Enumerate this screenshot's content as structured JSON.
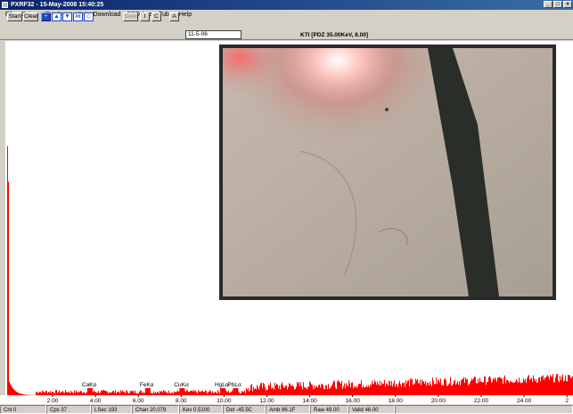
{
  "window": {
    "title": "PXRF32 - 15-May-2008 15:40:25"
  },
  "menu": [
    "File",
    "Setup",
    "ID",
    "Conv",
    "Cal",
    "Download",
    "PPD-Inte",
    "Tube",
    "Help"
  ],
  "toolbar": {
    "start": "Start",
    "clear": "Clear",
    "save": "Save",
    "i": "I",
    "c": "C",
    "a": "A",
    "sample_name": "11-5-06"
  },
  "status_label": "KTI  [PDZ 35.00KeV, 8.00]",
  "chart_data": {
    "type": "bar",
    "xlabel": "",
    "ylabel": "",
    "x_ticks": [
      "2.00",
      "4.00",
      "6.00",
      "8.00",
      "10.00",
      "12.00",
      "14.00",
      "16.00",
      "18.00",
      "20.00",
      "22.00",
      "24.00",
      "2"
    ],
    "annotations": [
      {
        "label": "CaKα",
        "x": 3.7
      },
      {
        "label": "FeKα",
        "x": 6.4
      },
      {
        "label": "CuKα",
        "x": 8.0
      },
      {
        "label": "HgLα",
        "x": 9.9
      },
      {
        "label": "PbLα",
        "x": 10.5
      }
    ],
    "bar_color": "#ff0000",
    "xlim": [
      0,
      26.5
    ]
  },
  "statusbar": {
    "cnt": "Cnt 0",
    "cps": "Cps 37",
    "lsec": "LSec 193",
    "chan": "Chan 20.079",
    "kev": "Kev  0.5100",
    "det": "Det -45.5C",
    "amb": "Amb 86.1F",
    "raw": "Raw 49.00",
    "valid": "Valid 46.00"
  }
}
